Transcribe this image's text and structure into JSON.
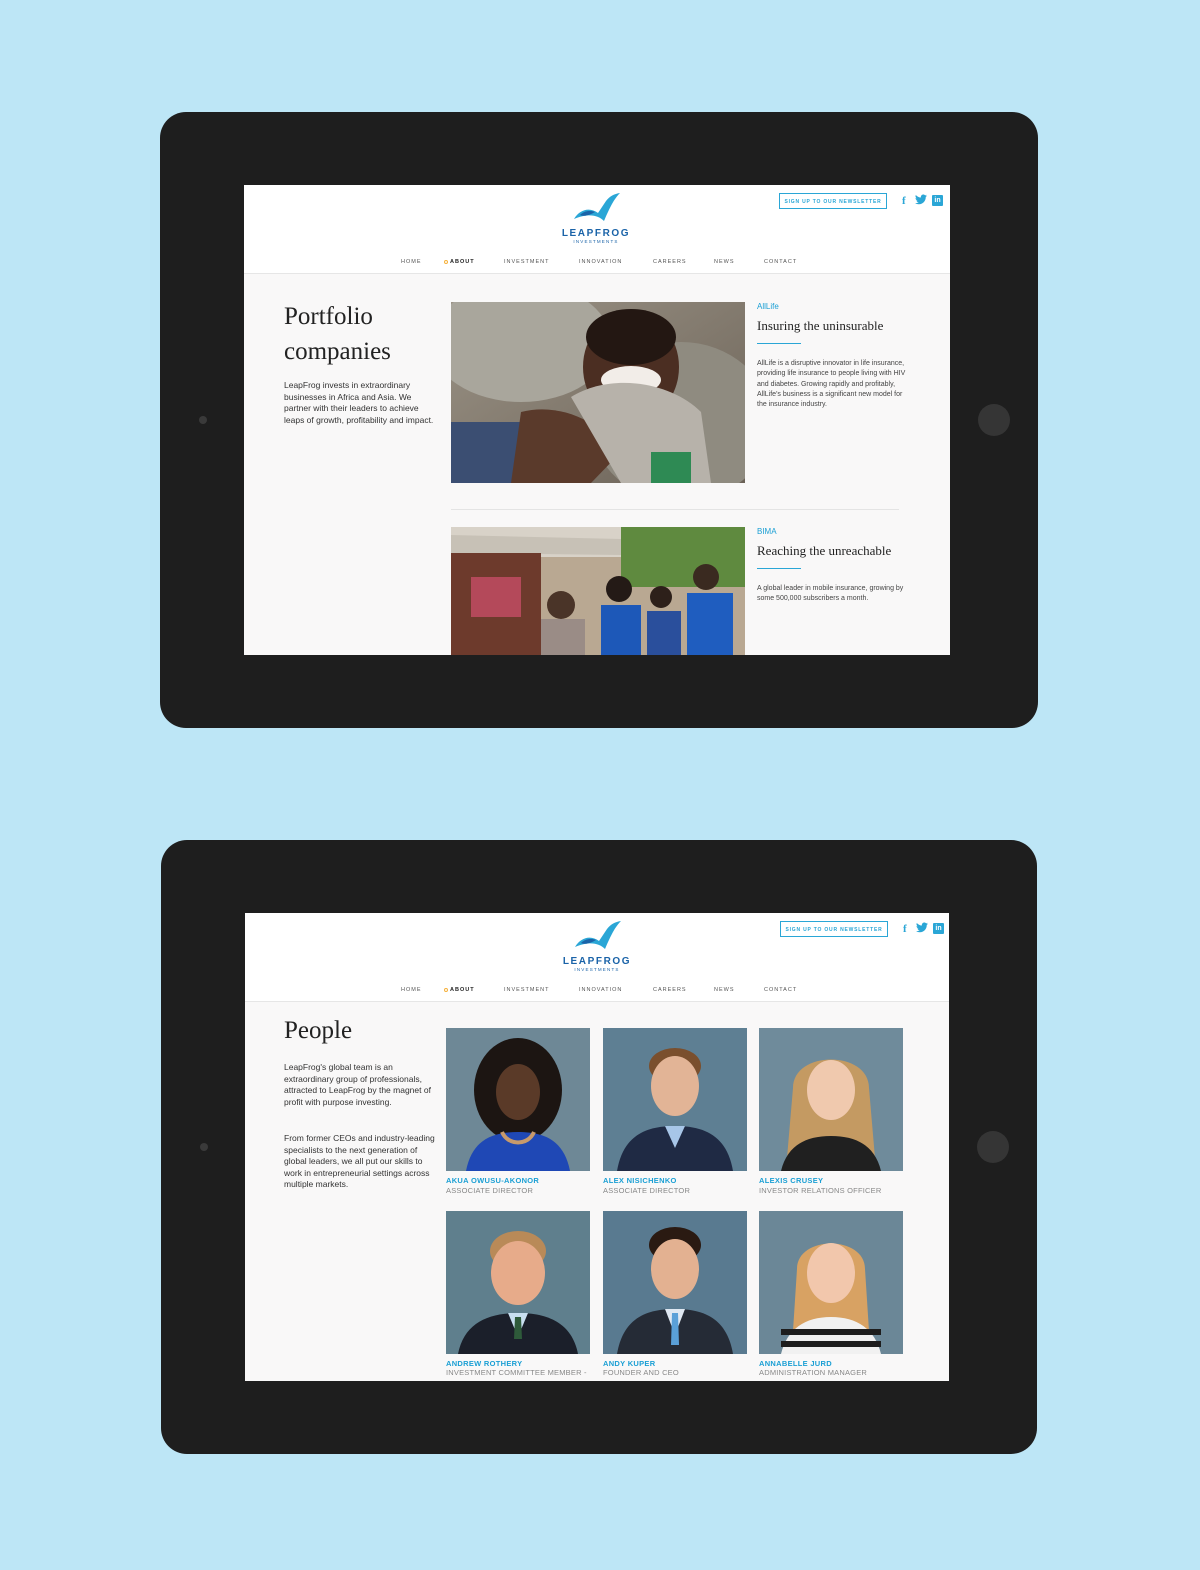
{
  "colors": {
    "background": "#bde6f6",
    "tablet": "#1e1e1e",
    "accent": "#2aa6d6",
    "brand": "#1a63a8"
  },
  "brand": {
    "logo_word": "LEAPFROG",
    "logo_sub": "INVESTMENTS"
  },
  "header": {
    "newsletter_label": "SIGN UP TO OUR NEWSLETTER",
    "social": [
      "facebook-icon",
      "twitter-icon",
      "linkedin-icon"
    ],
    "fb": "f",
    "tw": "🐦",
    "li": "in"
  },
  "nav": {
    "items": [
      {
        "label": "HOME"
      },
      {
        "label": "ABOUT",
        "active": true
      },
      {
        "label": "INVESTMENT"
      },
      {
        "label": "INNOVATION"
      },
      {
        "label": "CAREERS"
      },
      {
        "label": "NEWS"
      },
      {
        "label": "CONTACT"
      }
    ]
  },
  "portfolio": {
    "title_line1": "Portfolio",
    "title_line2": "companies",
    "intro": "LeapFrog invests in extraordinary businesses in Africa and Asia. We partner with their leaders to achieve leaps of growth, profitability and impact.",
    "companies": [
      {
        "name": "AllLife",
        "tagline": "Insuring the uninsurable",
        "description": "AllLife is a disruptive innovator in life insurance, providing life insurance to people living with HIV and diabetes. Growing rapidly and profitably, AllLife's business is a significant new model for the insurance industry."
      },
      {
        "name": "BIMA",
        "tagline": "Reaching the unreachable",
        "description": "A global leader in mobile insurance, growing by some 500,000 subscribers a month."
      }
    ]
  },
  "people": {
    "title": "People",
    "intro_p1": "LeapFrog's global team is an extraordinary group of professionals, attracted to LeapFrog by the magnet of profit with purpose investing.",
    "intro_p2": "From former CEOs and industry-leading specialists to the next generation of global leaders, we all put our skills to work in entrepreneurial settings across multiple markets.",
    "members": [
      {
        "name": "AKUA OWUSU-AKONOR",
        "role": "ASSOCIATE DIRECTOR"
      },
      {
        "name": "ALEX NISICHENKO",
        "role": "ASSOCIATE DIRECTOR"
      },
      {
        "name": "ALEXIS CRUSEY",
        "role": "INVESTOR RELATIONS OFFICER"
      },
      {
        "name": "ANDREW ROTHERY",
        "role": "INVESTMENT COMMITTEE MEMBER -"
      },
      {
        "name": "ANDY KUPER",
        "role": "FOUNDER AND CEO"
      },
      {
        "name": "ANNABELLE JURD",
        "role": "ADMINISTRATION MANAGER"
      }
    ]
  }
}
